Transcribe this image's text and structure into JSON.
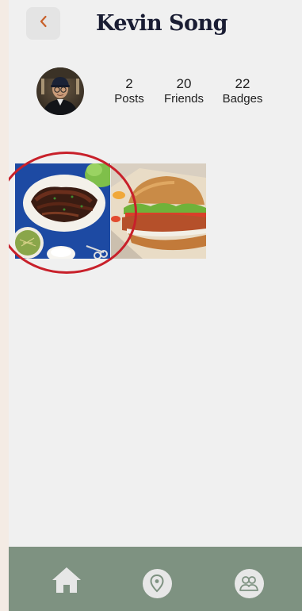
{
  "header": {
    "title": "Kevin Song",
    "back_icon": "chevron-left-icon"
  },
  "profile": {
    "avatar": "avatar-photo",
    "stats": [
      {
        "value": "2",
        "label": "Posts"
      },
      {
        "value": "20",
        "label": "Friends"
      },
      {
        "value": "22",
        "label": "Badges"
      }
    ]
  },
  "posts": [
    {
      "image": "galbi-ribs-photo"
    },
    {
      "image": "chicken-sandwich-photo"
    }
  ],
  "nav": {
    "items": [
      {
        "icon": "home-icon"
      },
      {
        "icon": "map-pin-icon"
      },
      {
        "icon": "friends-icon"
      }
    ]
  },
  "colors": {
    "accent": "#c8202a",
    "back_chevron": "#c8602a",
    "nav_bg": "#7e9281",
    "title": "#1a1d33"
  }
}
